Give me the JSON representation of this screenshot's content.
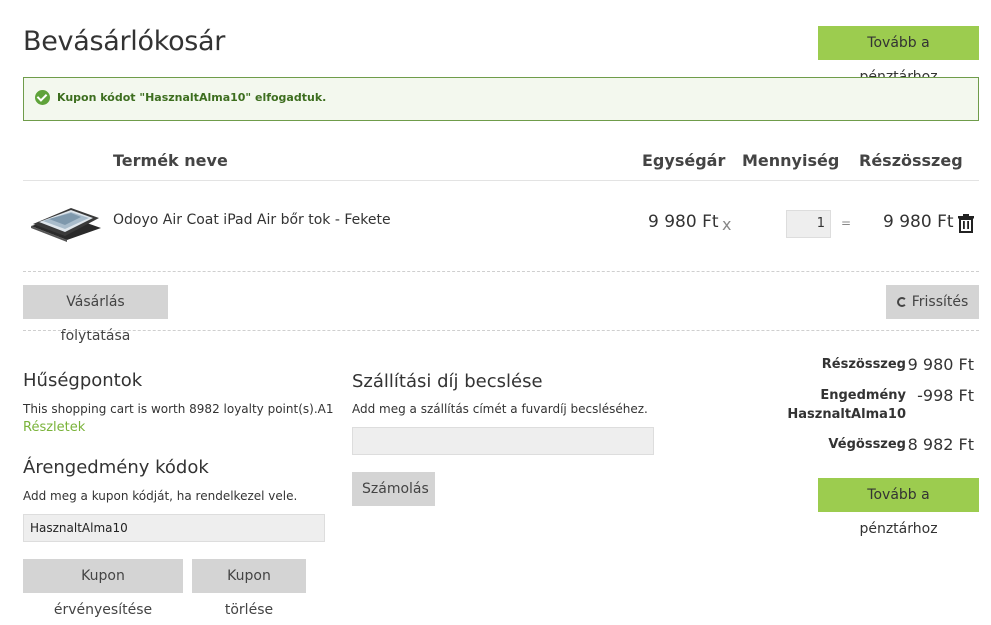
{
  "header": {
    "title": "Bevásárlókosár",
    "checkout_label": "Tovább a pénztárhoz"
  },
  "alert": {
    "message": "Kupon kódot \"HasznaltAlma10\" elfogadtuk."
  },
  "table": {
    "headers": {
      "name": "Termék neve",
      "unit_price": "Egységár",
      "quantity": "Mennyiség",
      "subtotal": "Részösszeg"
    },
    "rows": [
      {
        "name": "Odoyo Air Coat iPad Air bőr tok - Fekete",
        "unit_price": "9 980 Ft",
        "times": "x",
        "quantity": "1",
        "equals": "=",
        "subtotal": "9 980 Ft",
        "thumb_icon": "ipad-case-thumbnail",
        "remove_icon": "trash-icon"
      }
    ]
  },
  "actions": {
    "continue_label": "Vásárlás folytatása",
    "refresh_label": "Frissítés",
    "refresh_icon": "refresh-icon"
  },
  "loyalty": {
    "title": "Hűségpontok",
    "text": "This shopping cart is worth 8982 loyalty point(s).A1",
    "link": "Részletek"
  },
  "coupon": {
    "title": "Árengedmény kódok",
    "text": "Add meg a kupon kódját, ha rendelkezel vele.",
    "value": "HasznaltAlma10",
    "apply_label": "Kupon érvényesítése",
    "remove_label": "Kupon törlése"
  },
  "shipping": {
    "title": "Szállítási díj becslése",
    "text": "Add meg a szállítás címét a fuvardíj becsléséhez.",
    "value": "",
    "calc_label": "Számolás"
  },
  "summary": {
    "subtotal_label": "Részösszeg",
    "subtotal_value": "9 980 Ft",
    "discount_label_1": "Engedmény",
    "discount_label_2": "HasznaltAlma10",
    "discount_value": "-998 Ft",
    "total_label": "Végösszeg",
    "total_value": "8 982 Ft",
    "checkout_label": "Tovább a pénztárhoz"
  },
  "colors": {
    "accent_green": "#9ccc4f",
    "alert_border": "#6f9c4a",
    "button_gray": "#d4d4d4"
  }
}
